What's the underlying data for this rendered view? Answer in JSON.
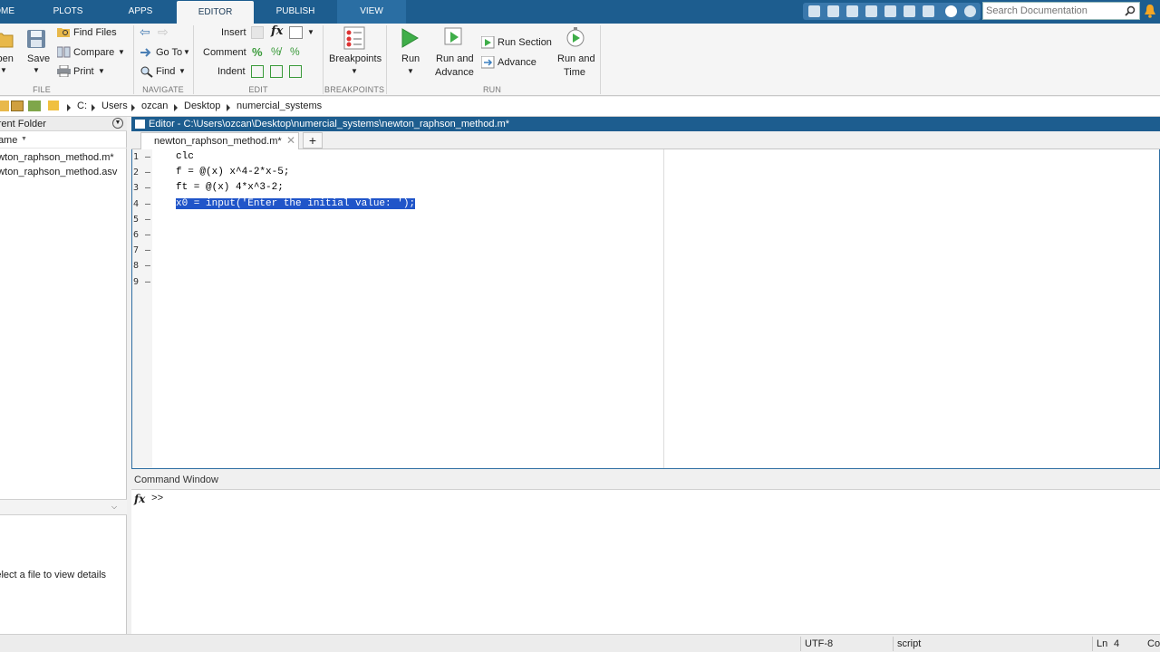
{
  "tabs": [
    {
      "label": "HOME"
    },
    {
      "label": "PLOTS"
    },
    {
      "label": "APPS"
    },
    {
      "label": "EDITOR"
    },
    {
      "label": "PUBLISH"
    },
    {
      "label": "VIEW"
    }
  ],
  "search": {
    "placeholder": "Search Documentation"
  },
  "ribbon": {
    "file": {
      "open": "Open",
      "save": "Save",
      "find_files": "Find Files",
      "compare": "Compare",
      "print": "Print",
      "group": "FILE"
    },
    "navigate": {
      "goto": "Go To",
      "find": "Find",
      "group": "NAVIGATE"
    },
    "edit": {
      "insert": "Insert",
      "comment": "Comment",
      "indent": "Indent",
      "group": "EDIT"
    },
    "breakpoints": {
      "label": "Breakpoints",
      "group": "BREAKPOINTS"
    },
    "run": {
      "run": "Run",
      "run_advance_1": "Run and",
      "run_advance_2": "Advance",
      "run_section": "Run Section",
      "advance": "Advance",
      "run_time_1": "Run and",
      "run_time_2": "Time",
      "group": "RUN"
    }
  },
  "address": {
    "crumbs": [
      "C:",
      "Users",
      "ozcan",
      "Desktop",
      "numercial_systems"
    ]
  },
  "current_folder": {
    "title": "Current Folder",
    "column": "Name",
    "files": [
      "newton_raphson_method.m*",
      "newton_raphson_method.asv"
    ],
    "details_text": "Select a file to view details"
  },
  "editor": {
    "title": "Editor - C:\\Users\\ozcan\\Desktop\\numercial_systems\\newton_raphson_method.m*",
    "file_tab": "newton_raphson_method.m*",
    "add_tab": "+",
    "lines": [
      {
        "num": "1",
        "code": "clc"
      },
      {
        "num": "2",
        "code": "f = @(x) x^4-2*x-5;"
      },
      {
        "num": "3",
        "code": "ft = @(x) 4*x^3-2;"
      },
      {
        "num": "4",
        "code": "x0 = input('Enter the initial value: ');"
      },
      {
        "num": "5",
        "code": ""
      },
      {
        "num": "6",
        "code": ""
      },
      {
        "num": "7",
        "code": ""
      },
      {
        "num": "8",
        "code": ""
      },
      {
        "num": "9",
        "code": ""
      }
    ],
    "dash": "–",
    "selected_line": 4
  },
  "command_window": {
    "title": "Command Window",
    "prompt": ">>",
    "fx": "fx"
  },
  "status": {
    "encoding": "UTF-8",
    "type": "script",
    "ln_label": "Ln",
    "ln_value": "4",
    "col_label": "Col"
  },
  "colors": {
    "accent": "#1d5d8f",
    "selection": "#2055c9"
  }
}
